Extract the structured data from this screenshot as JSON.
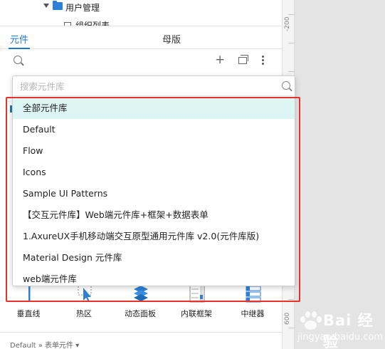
{
  "tree": {
    "folder_label": "用户管理",
    "child_label": "组织列表"
  },
  "tabs": [
    {
      "label": "元件",
      "active": true
    },
    {
      "label": "母版",
      "active": false
    }
  ],
  "toolbar": {
    "add_symbol": "+"
  },
  "dropdown": {
    "search_placeholder": "搜索元件库",
    "items": [
      "全部元件库",
      "Default",
      "Flow",
      "Icons",
      "Sample UI Patterns",
      "【交互元件库】Web端元件库+框架+数据表单",
      "1.AxureUX手机移动端交互原型通用元件库 v2.0(元件库版)",
      "Material Design 元件库",
      "web端元件库"
    ],
    "selected_index": 0
  },
  "widgets": [
    {
      "label": "垂直线",
      "icon": "vertical-line-icon"
    },
    {
      "label": "热区",
      "icon": "hot-spot-icon"
    },
    {
      "label": "动态面板",
      "icon": "dynamic-panel-icon"
    },
    {
      "label": "内联框架",
      "icon": "inline-frame-icon"
    },
    {
      "label": "中继器",
      "icon": "repeater-icon"
    }
  ],
  "footer": {
    "breadcrumb": "Default » 表单元件 ▾"
  },
  "ruler": {
    "labels": [
      "-200",
      "600"
    ]
  },
  "watermark": {
    "brand": "Bai 经验",
    "url": "jingyan.baidu.com"
  },
  "colors": {
    "accent": "#1f78c8",
    "selected_bg": "#ddf5f5",
    "highlight_border": "#e5322a",
    "folder": "#2f7fd7"
  }
}
